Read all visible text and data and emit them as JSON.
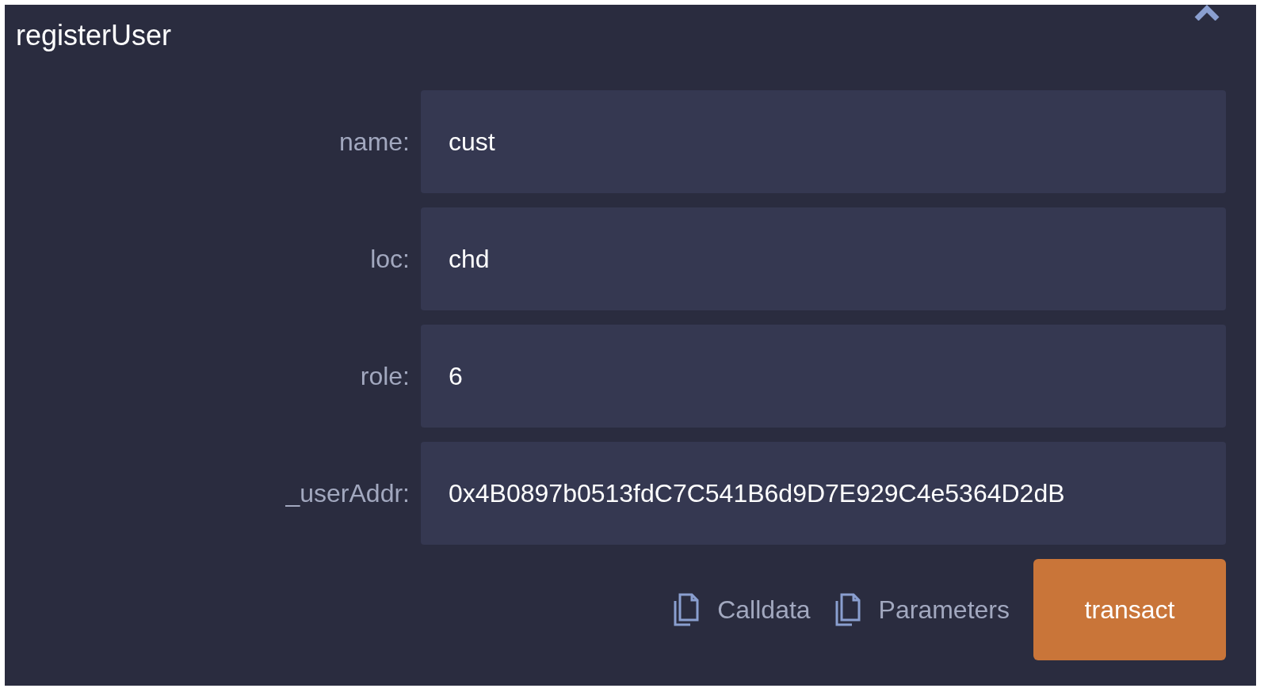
{
  "title": "registerUser",
  "fields": [
    {
      "label": "name:",
      "value": "cust"
    },
    {
      "label": "loc:",
      "value": "chd"
    },
    {
      "label": "role:",
      "value": "6"
    },
    {
      "label": "_userAddr:",
      "value": "0x4B0897b0513fdC7C541B6d9D7E929C4e5364D2dB"
    }
  ],
  "actions": [
    {
      "kind": "copy",
      "label": "Calldata"
    },
    {
      "kind": "copy",
      "label": "Parameters"
    },
    {
      "kind": "primary",
      "label": "transact"
    }
  ]
}
